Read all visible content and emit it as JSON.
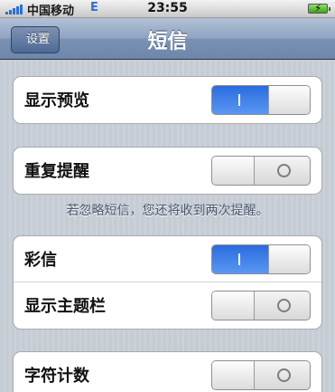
{
  "status_bar": {
    "carrier": "中国移动",
    "network": "E",
    "time": "23:55"
  },
  "nav": {
    "back_label": "设置",
    "title": "短信"
  },
  "settings": [
    {
      "label": "显示预览",
      "on": true
    },
    {
      "label": "重复提醒",
      "on": false
    },
    {
      "label": "彩信",
      "on": true
    },
    {
      "label": "显示主题栏",
      "on": false
    },
    {
      "label": "字符计数",
      "on": false
    }
  ],
  "repeat_note": "若忽略短信，您还将收到两次提醒。",
  "colors": {
    "switch_on": "#2a6ce0",
    "nav_bar": "#8ea3c1"
  }
}
